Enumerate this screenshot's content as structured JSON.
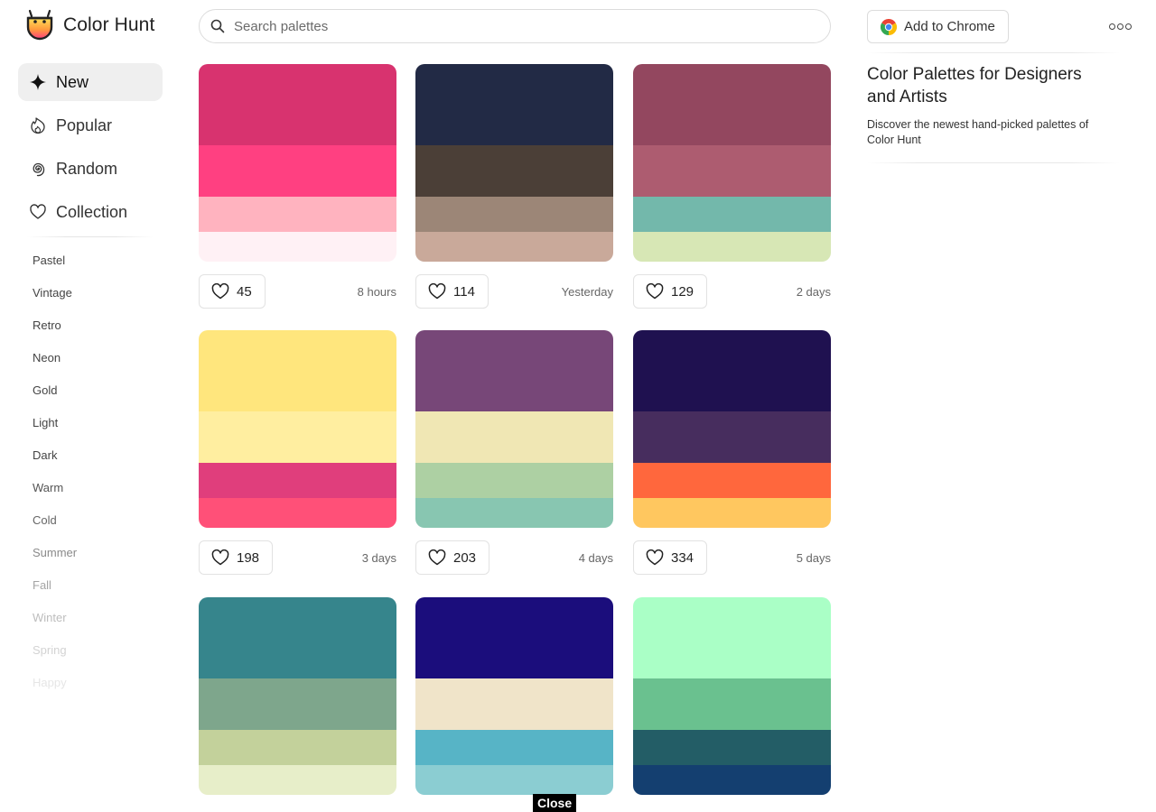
{
  "brand": {
    "name": "Color Hunt"
  },
  "search": {
    "placeholder": "Search palettes"
  },
  "header": {
    "chrome_button_label": "Add to Chrome"
  },
  "nav": [
    {
      "label": "New",
      "icon": "sparkle-icon",
      "active": true
    },
    {
      "label": "Popular",
      "icon": "flame-icon",
      "active": false
    },
    {
      "label": "Random",
      "icon": "spiral-icon",
      "active": false
    },
    {
      "label": "Collection",
      "icon": "heart-icon",
      "active": false
    }
  ],
  "tags": [
    {
      "label": "Pastel",
      "color": "#444444"
    },
    {
      "label": "Vintage",
      "color": "#444444"
    },
    {
      "label": "Retro",
      "color": "#444444"
    },
    {
      "label": "Neon",
      "color": "#444444"
    },
    {
      "label": "Gold",
      "color": "#444444"
    },
    {
      "label": "Light",
      "color": "#444444"
    },
    {
      "label": "Dark",
      "color": "#444444"
    },
    {
      "label": "Warm",
      "color": "#555555"
    },
    {
      "label": "Cold",
      "color": "#666666"
    },
    {
      "label": "Summer",
      "color": "#8a8a8a"
    },
    {
      "label": "Fall",
      "color": "#a5a5a5"
    },
    {
      "label": "Winter",
      "color": "#bdbdbd"
    },
    {
      "label": "Spring",
      "color": "#d3d3d3"
    },
    {
      "label": "Happy",
      "color": "#e6e6e6"
    }
  ],
  "palettes": [
    {
      "colors": [
        "#D8336F",
        "#FF4081",
        "#FFB3BF",
        "#FFF1F5"
      ],
      "likes": "45",
      "time": "8 hours"
    },
    {
      "colors": [
        "#222A45",
        "#4B3F37",
        "#9C8677",
        "#C9A99A"
      ],
      "likes": "114",
      "time": "Yesterday"
    },
    {
      "colors": [
        "#93475F",
        "#AD5C70",
        "#73B8AB",
        "#D7E7B5"
      ],
      "likes": "129",
      "time": "2 days"
    },
    {
      "colors": [
        "#FFE67D",
        "#FFEEA0",
        "#E03E7C",
        "#FF5078"
      ],
      "likes": "198",
      "time": "3 days"
    },
    {
      "colors": [
        "#774778",
        "#F0E7B4",
        "#ADD0A3",
        "#88C6B1"
      ],
      "likes": "203",
      "time": "4 days"
    },
    {
      "colors": [
        "#1F1150",
        "#472D5E",
        "#FF673D",
        "#FFC75F"
      ],
      "likes": "334",
      "time": "5 days"
    },
    {
      "colors": [
        "#36858C",
        "#7EA68C",
        "#C3D19B",
        "#E7EEC9"
      ],
      "likes": "",
      "time": ""
    },
    {
      "colors": [
        "#1B0D7C",
        "#F0E4C9",
        "#57B4C6",
        "#8BCDD2"
      ],
      "likes": "",
      "time": ""
    },
    {
      "colors": [
        "#AAFFC6",
        "#6AC18F",
        "#235D66",
        "#143F70"
      ],
      "likes": "",
      "time": ""
    }
  ],
  "panel": {
    "title": "Color Palettes for Designers and Artists",
    "description": "Discover the newest hand-picked palettes of Color Hunt"
  },
  "overlay": {
    "close_label": "Close"
  }
}
